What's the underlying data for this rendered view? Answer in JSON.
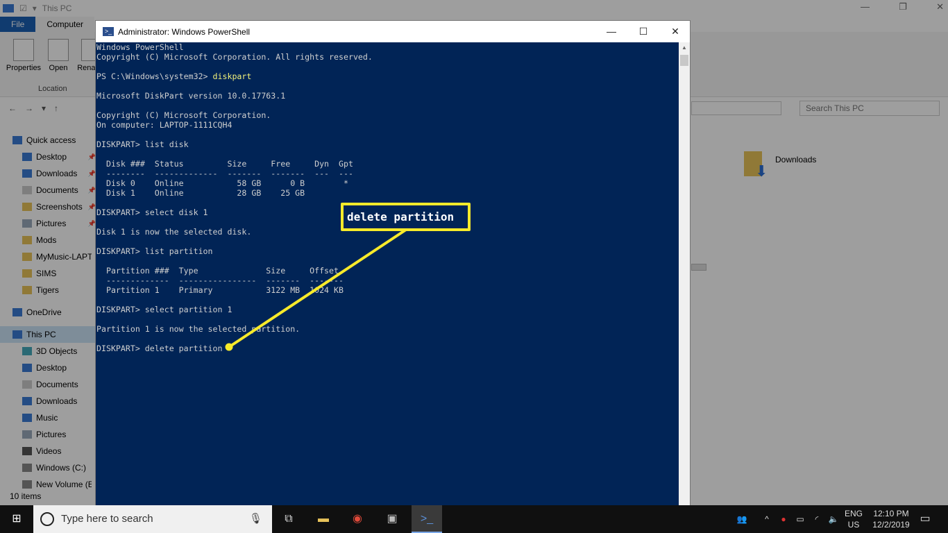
{
  "explorer": {
    "title": "This PC",
    "tabs": [
      "File",
      "Computer"
    ],
    "ribbon_buttons": [
      "Properties",
      "Open",
      "Rename"
    ],
    "ribbon_group": "Location",
    "search_placeholder": "Search This PC",
    "sidebar": [
      {
        "label": "Quick access",
        "icon": "star-icon"
      },
      {
        "label": "Desktop",
        "icon": "desktop-icon",
        "pinned": true
      },
      {
        "label": "Downloads",
        "icon": "download-icon",
        "pinned": true
      },
      {
        "label": "Documents",
        "icon": "document-icon",
        "pinned": true
      },
      {
        "label": "Screenshots",
        "icon": "folder-icon",
        "pinned": true
      },
      {
        "label": "Pictures",
        "icon": "pictures-icon",
        "pinned": true
      },
      {
        "label": "Mods",
        "icon": "folder-icon"
      },
      {
        "label": "MyMusic-LAPTOP",
        "icon": "folder-icon"
      },
      {
        "label": "SIMS",
        "icon": "folder-icon"
      },
      {
        "label": "Tigers",
        "icon": "folder-icon"
      },
      {
        "label": "OneDrive",
        "icon": "cloud-icon"
      },
      {
        "label": "This PC",
        "icon": "computer-icon",
        "selected": true
      },
      {
        "label": "3D Objects",
        "icon": "cube-icon"
      },
      {
        "label": "Desktop",
        "icon": "desktop-icon"
      },
      {
        "label": "Documents",
        "icon": "document-icon"
      },
      {
        "label": "Downloads",
        "icon": "download-icon"
      },
      {
        "label": "Music",
        "icon": "music-icon"
      },
      {
        "label": "Pictures",
        "icon": "pictures-icon"
      },
      {
        "label": "Videos",
        "icon": "video-icon"
      },
      {
        "label": "Windows (C:)",
        "icon": "drive-icon"
      },
      {
        "label": "New Volume (E:)",
        "icon": "drive-icon"
      }
    ],
    "content_folder": "Downloads",
    "status": "10 items"
  },
  "powershell": {
    "title": "Administrator: Windows PowerShell",
    "lines": [
      {
        "text": "Windows PowerShell"
      },
      {
        "text": "Copyright (C) Microsoft Corporation. All rights reserved."
      },
      {
        "text": ""
      },
      {
        "text": "PS C:\\Windows\\system32> ",
        "cmd": "diskpart"
      },
      {
        "text": ""
      },
      {
        "text": "Microsoft DiskPart version 10.0.17763.1"
      },
      {
        "text": ""
      },
      {
        "text": "Copyright (C) Microsoft Corporation."
      },
      {
        "text": "On computer: LAPTOP-1111CQH4"
      },
      {
        "text": ""
      },
      {
        "text": "DISKPART> list disk"
      },
      {
        "text": ""
      },
      {
        "text": "  Disk ###  Status         Size     Free     Dyn  Gpt"
      },
      {
        "text": "  --------  -------------  -------  -------  ---  ---"
      },
      {
        "text": "  Disk 0    Online           58 GB      0 B        *"
      },
      {
        "text": "  Disk 1    Online           28 GB    25 GB"
      },
      {
        "text": ""
      },
      {
        "text": "DISKPART> select disk 1"
      },
      {
        "text": ""
      },
      {
        "text": "Disk 1 is now the selected disk."
      },
      {
        "text": ""
      },
      {
        "text": "DISKPART> list partition"
      },
      {
        "text": ""
      },
      {
        "text": "  Partition ###  Type              Size     Offset"
      },
      {
        "text": "  -------------  ----------------  -------  -------"
      },
      {
        "text": "  Partition 1    Primary           3122 MB  1024 KB"
      },
      {
        "text": ""
      },
      {
        "text": "DISKPART> select partition 1"
      },
      {
        "text": ""
      },
      {
        "text": "Partition 1 is now the selected partition."
      },
      {
        "text": ""
      },
      {
        "text": "DISKPART> delete partition"
      }
    ]
  },
  "callout": {
    "text": "delete partition",
    "color": "#f7ea2a"
  },
  "taskbar": {
    "search_placeholder": "Type here to search",
    "language": "ENG",
    "region": "US",
    "time": "12:10 PM",
    "date": "12/2/2019"
  }
}
